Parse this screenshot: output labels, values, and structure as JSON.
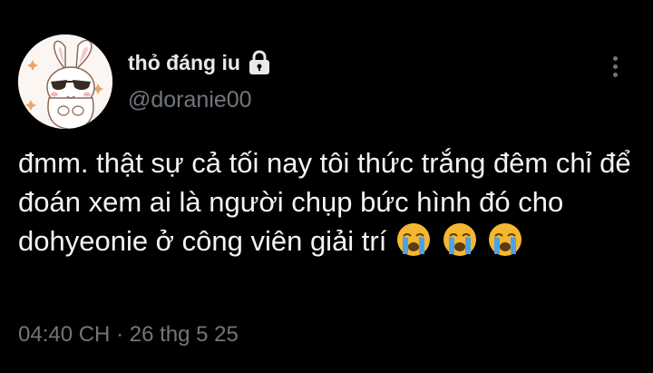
{
  "author": {
    "display_name": "thỏ đáng iu",
    "handle": "@doranie00",
    "protected_icon": "lock-icon",
    "avatar_icon": "bunny-with-sunglasses-avatar"
  },
  "menu": {
    "icon": "more-vertical-icon"
  },
  "tweet": {
    "text_main": "đmm. thật sự cả tối nay tôi thức trắng đêm chỉ để đoán xem ai là người chụp bức hình đó cho dohyeonie ở công viên giải trí",
    "emoji_name": "loudly-crying-face-icon",
    "emoji_count": 3
  },
  "meta": {
    "time": "04:40 CH",
    "separator": "·",
    "date": "26 thg 5 25"
  },
  "colors": {
    "background": "#000000",
    "text_primary": "#e7e9ea",
    "text_secondary": "#71767b"
  }
}
